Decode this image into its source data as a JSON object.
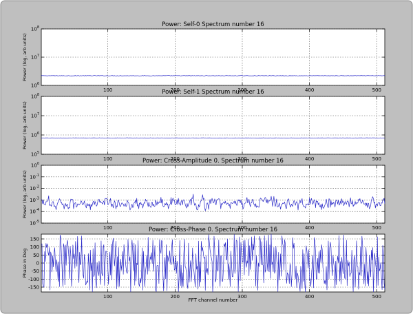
{
  "chart_data": [
    {
      "type": "line",
      "title": "Power: Self-0 Spectrum number 16",
      "ylabel": "Power (log, arb units)",
      "xlabel": "",
      "yscale": "log",
      "xlim": [
        1,
        512
      ],
      "ylim_exp": [
        6,
        8
      ],
      "xticks": [
        100,
        200,
        300,
        400,
        500
      ],
      "yticks": [
        {
          "base": "10",
          "exp": "6"
        },
        {
          "base": "10",
          "exp": "7"
        },
        {
          "base": "10",
          "exp": "8"
        }
      ],
      "grid": true,
      "series_color": "#2a2ac8",
      "series": [
        {
          "kind": "flat",
          "value": 2200000,
          "jitter_dec": 0.008
        }
      ]
    },
    {
      "type": "line",
      "title": "Power: Self-1 Spectrum number 16",
      "ylabel": "Power (log, arb units)",
      "xlabel": "",
      "yscale": "log",
      "xlim": [
        1,
        512
      ],
      "ylim_exp": [
        5,
        8
      ],
      "xticks": [
        100,
        200,
        300,
        400,
        500
      ],
      "yticks": [
        {
          "base": "10",
          "exp": "5"
        },
        {
          "base": "10",
          "exp": "6"
        },
        {
          "base": "10",
          "exp": "7"
        },
        {
          "base": "10",
          "exp": "8"
        }
      ],
      "grid": true,
      "series_color": "#2a2ac8",
      "series": [
        {
          "kind": "flat",
          "value": 700000,
          "jitter_dec": 0.008
        }
      ]
    },
    {
      "type": "line",
      "title": "Power: Cross-Amplitude 0. Spectrum number 16",
      "ylabel": "Power (log, arb units)",
      "xlabel": "",
      "yscale": "log",
      "xlim": [
        1,
        512
      ],
      "ylim_exp": [
        -5,
        0
      ],
      "xticks": [
        100,
        200,
        300,
        400,
        500
      ],
      "yticks": [
        {
          "base": "10",
          "exp": "-5"
        },
        {
          "base": "10",
          "exp": "-4"
        },
        {
          "base": "10",
          "exp": "-3"
        },
        {
          "base": "10",
          "exp": "-2"
        },
        {
          "base": "10",
          "exp": "-1"
        },
        {
          "base": "10",
          "exp": "0"
        }
      ],
      "grid": true,
      "series_color": "#2a2ac8",
      "series": [
        {
          "kind": "noise",
          "center_exp": -3.3,
          "spread_dec": 0.35,
          "clip_exp": [
            -4.6,
            -2.4
          ]
        }
      ]
    },
    {
      "type": "line",
      "title": "Power: Cross-Phase 0. Spectrum number 16",
      "ylabel": "Phase in Deg",
      "xlabel": "FFT channel number",
      "yscale": "linear",
      "xlim": [
        1,
        512
      ],
      "ylim": [
        -180,
        180
      ],
      "xticks": [
        100,
        200,
        300,
        400,
        500
      ],
      "yticks": [
        "-150",
        "-100",
        "-50",
        "0",
        "50",
        "100",
        "150"
      ],
      "grid": true,
      "series_color": "#2a2ac8",
      "series": [
        {
          "kind": "uniform",
          "range": [
            -180,
            180
          ]
        }
      ]
    }
  ]
}
